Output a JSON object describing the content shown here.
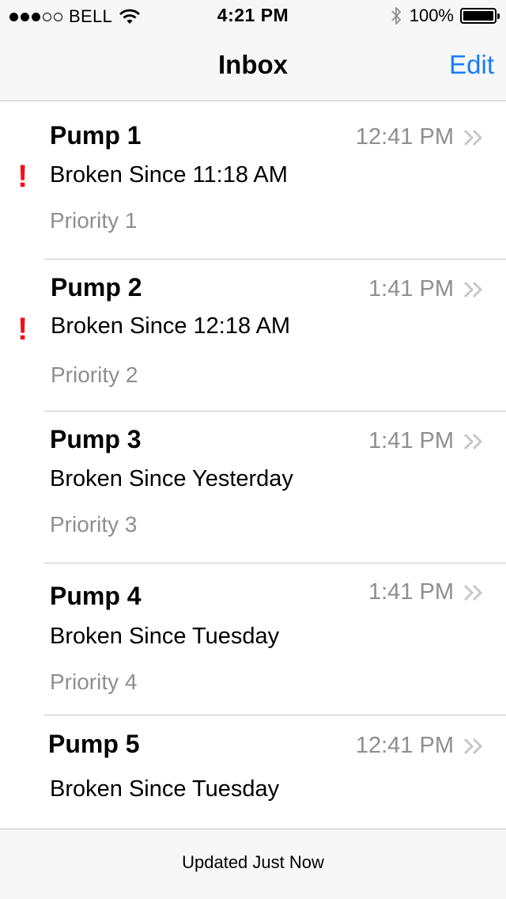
{
  "status_bar": {
    "carrier": "BELL",
    "signal_bars_filled": 3,
    "signal_bars_total": 5,
    "time": "4:21 PM",
    "battery": "100%"
  },
  "nav": {
    "title": "Inbox",
    "edit_label": "Edit"
  },
  "messages": [
    {
      "title": "Pump 1",
      "subtitle": "Broken Since 11:18 AM",
      "priority": "Priority 1",
      "time": "12:41 PM",
      "flag": "!"
    },
    {
      "title": "Pump 2",
      "subtitle": "Broken Since 12:18 AM",
      "priority": "Priority 2",
      "time": "1:41 PM",
      "flag": "!"
    },
    {
      "title": "Pump 3",
      "subtitle": "Broken Since Yesterday",
      "priority": "Priority 3",
      "time": "1:41 PM"
    },
    {
      "title": "Pump 4",
      "subtitle": "Broken Since Tuesday",
      "priority": "Priority 4",
      "time": "1:41 PM"
    },
    {
      "title": "Pump 5",
      "subtitle": "Broken Since Tuesday",
      "time": "12:41 PM"
    }
  ],
  "toolbar": {
    "status_text": "Updated Just Now"
  },
  "colors": {
    "accent": "#147efb",
    "flag": "#e8141c",
    "secondary_text": "#8e8e93"
  },
  "icons": [
    "wifi-icon",
    "bluetooth-icon",
    "battery-icon",
    "flag-icon",
    "double-chevron-icon"
  ]
}
